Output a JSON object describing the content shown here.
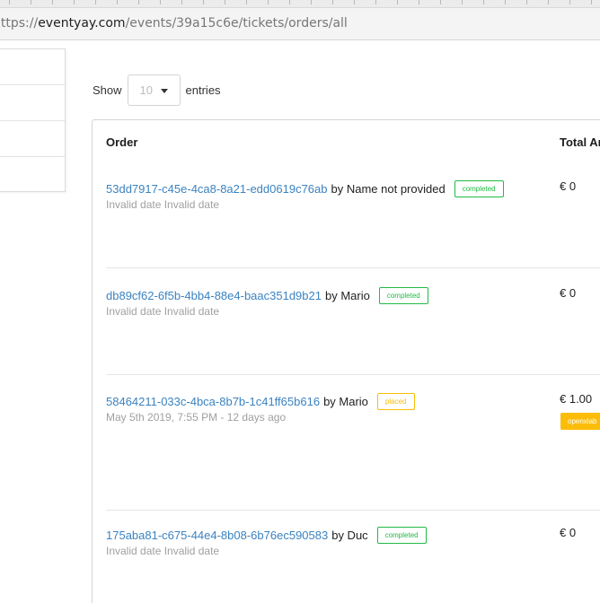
{
  "browser": {
    "url_prefix": "https://",
    "url_domain": "eventyay.com",
    "url_path": "/events/39a15c6e/tickets/orders/all"
  },
  "entries_control": {
    "show_label": "Show",
    "selected_value": "10",
    "entries_label": "entries"
  },
  "table": {
    "columns": [
      "Order",
      "Total Amount"
    ],
    "rows": [
      {
        "order_id": "53dd7917-c45e-4ca8-8a21-edd0619c76ab",
        "by_text": "by Name not provided",
        "status": "completed",
        "date": "Invalid date Invalid date",
        "total": "€ 0"
      },
      {
        "order_id": "db89cf62-6f5b-4bb4-88e4-baac351d9b21",
        "by_text": "by Mario",
        "status": "completed",
        "date": "Invalid date Invalid date",
        "total": "€ 0"
      },
      {
        "order_id": "58464211-033c-4bca-8b7b-1c41ff65b616",
        "by_text": "by Mario",
        "status": "placed",
        "date": "May 5th 2019, 7:55 PM - 12 days ago",
        "total": "€ 1.00",
        "discount_code": "openxlab"
      },
      {
        "order_id": "175aba81-c675-44e4-8b08-6b76ec590583",
        "by_text": "by Duc",
        "status": "completed",
        "date": "Invalid date Invalid date",
        "total": "€ 0"
      }
    ]
  },
  "colors": {
    "link": "#3b83c0",
    "completed": "#21ba45",
    "placed": "#fbbd08"
  }
}
